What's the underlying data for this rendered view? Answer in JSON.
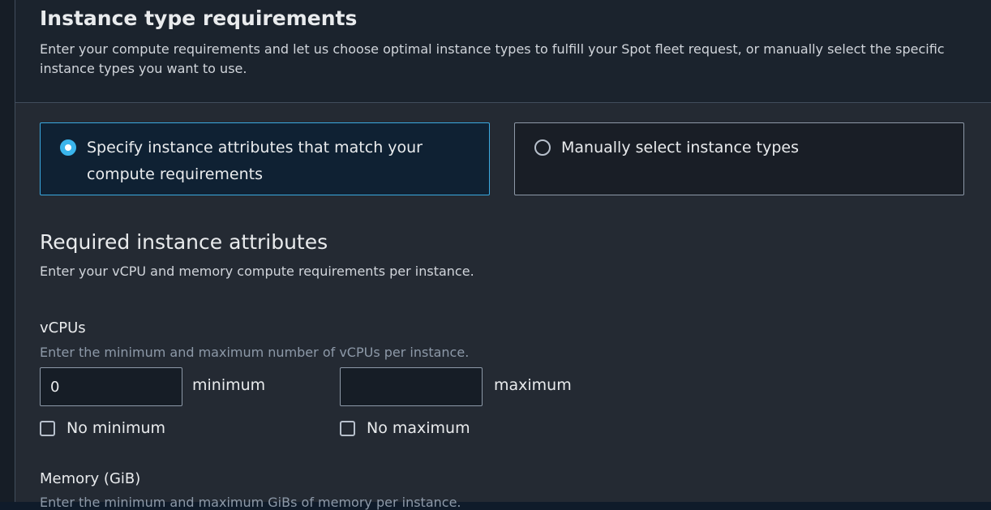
{
  "header": {
    "title": "Instance type requirements",
    "description": "Enter your compute requirements and let us choose optimal instance types to fulfill your Spot fleet request, or manually select the specific instance types you want to use."
  },
  "selection": {
    "options": [
      {
        "label": "Specify instance attributes that match your compute requirements",
        "selected": true
      },
      {
        "label": "Manually select instance types",
        "selected": false
      }
    ]
  },
  "required": {
    "title": "Required instance attributes",
    "description": "Enter your vCPU and memory compute requirements per instance."
  },
  "vcpus": {
    "label": "vCPUs",
    "description": "Enter the minimum and maximum number of vCPUs per instance.",
    "min_value": "0",
    "min_suffix": "minimum",
    "max_value": "",
    "max_suffix": "maximum",
    "no_min_label": "No minimum",
    "no_max_label": "No maximum"
  },
  "memory": {
    "label": "Memory (GiB)",
    "description": "Enter the minimum and maximum GiBs of memory per instance."
  },
  "colors": {
    "accent": "#3ab5ec",
    "selected_tile_bg": "#0f2133",
    "panel_bg": "#242a33",
    "header_bg": "#1b232d"
  }
}
